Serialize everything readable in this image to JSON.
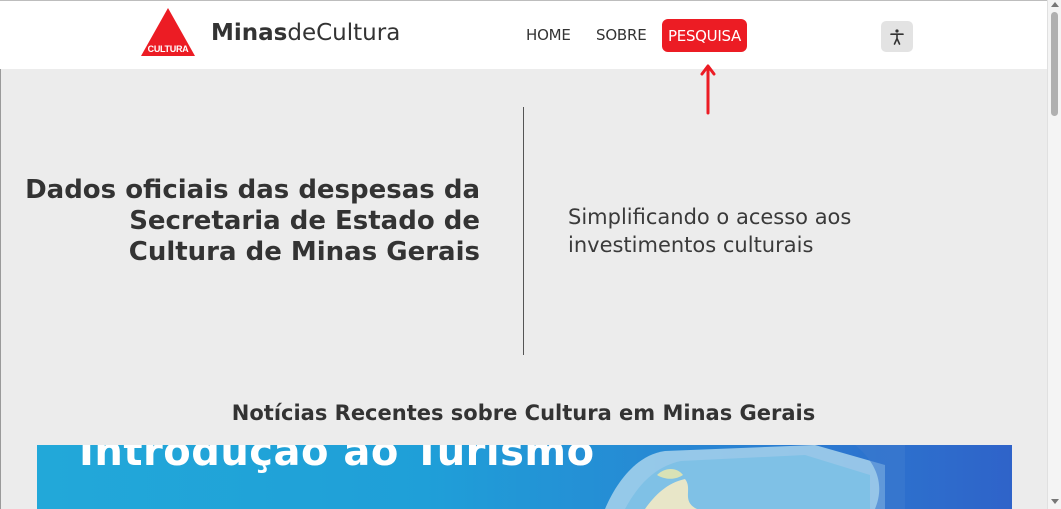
{
  "header": {
    "logo_text": "CULTURA",
    "brand_bold": "Minas",
    "brand_regular": "deCultura",
    "nav": {
      "home": "HOME",
      "sobre": "SOBRE",
      "pesquisa": "PESQUISA"
    },
    "accessibility_icon": "accessibility-icon"
  },
  "hero": {
    "title": "Dados oficiais das despesas da Secretaria de Estado de Cultura de Minas Gerais",
    "tagline": "Simplificando o acesso aos investimentos culturais"
  },
  "news": {
    "heading": "Notícias Recentes sobre Cultura em Minas Gerais",
    "banner_text": "Introdução ao Turismo"
  },
  "colors": {
    "accent_red": "#ec1c24",
    "background": "#ececec",
    "header_bg": "#ffffff"
  }
}
